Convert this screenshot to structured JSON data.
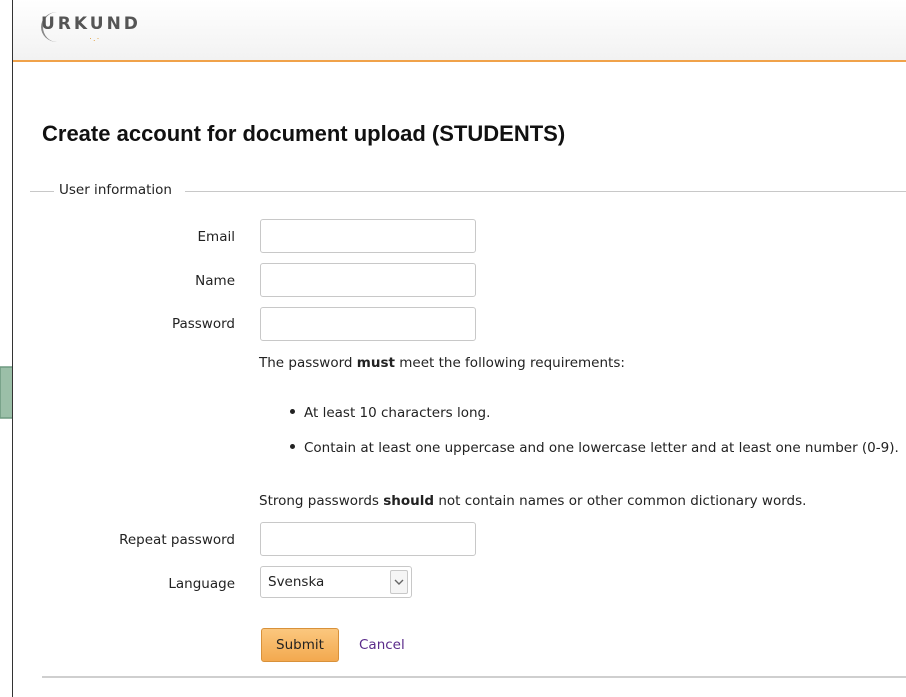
{
  "header": {
    "logo_text": "URKUND"
  },
  "page": {
    "title": "Create account for document upload (STUDENTS)"
  },
  "fieldset": {
    "legend": "User information"
  },
  "form": {
    "email_label": "Email",
    "email_value": "",
    "name_label": "Name",
    "name_value": "",
    "password_label": "Password",
    "password_value": "",
    "requirements_prefix": "The password ",
    "requirements_bold": "must",
    "requirements_suffix": " meet the following requirements:",
    "requirements": [
      "At least 10 characters long.",
      "Contain at least one uppercase and one lowercase letter and at least one number (0-9)."
    ],
    "strong_prefix": "Strong passwords ",
    "strong_bold": "should",
    "strong_suffix": " not contain names or other common dictionary words.",
    "repeat_password_label": "Repeat password",
    "repeat_password_value": "",
    "language_label": "Language",
    "language_selected": "Svenska",
    "submit_label": "Submit",
    "cancel_label": "Cancel"
  },
  "colors": {
    "accent_orange": "#f0a24a",
    "submit_bg": "#f3a94f",
    "link_purple": "#5a2a8a",
    "callout_arrow": "#9bbfa8"
  },
  "icons": {
    "select_arrow": "chevron-down-icon",
    "callout": "right-arrow-icon"
  }
}
